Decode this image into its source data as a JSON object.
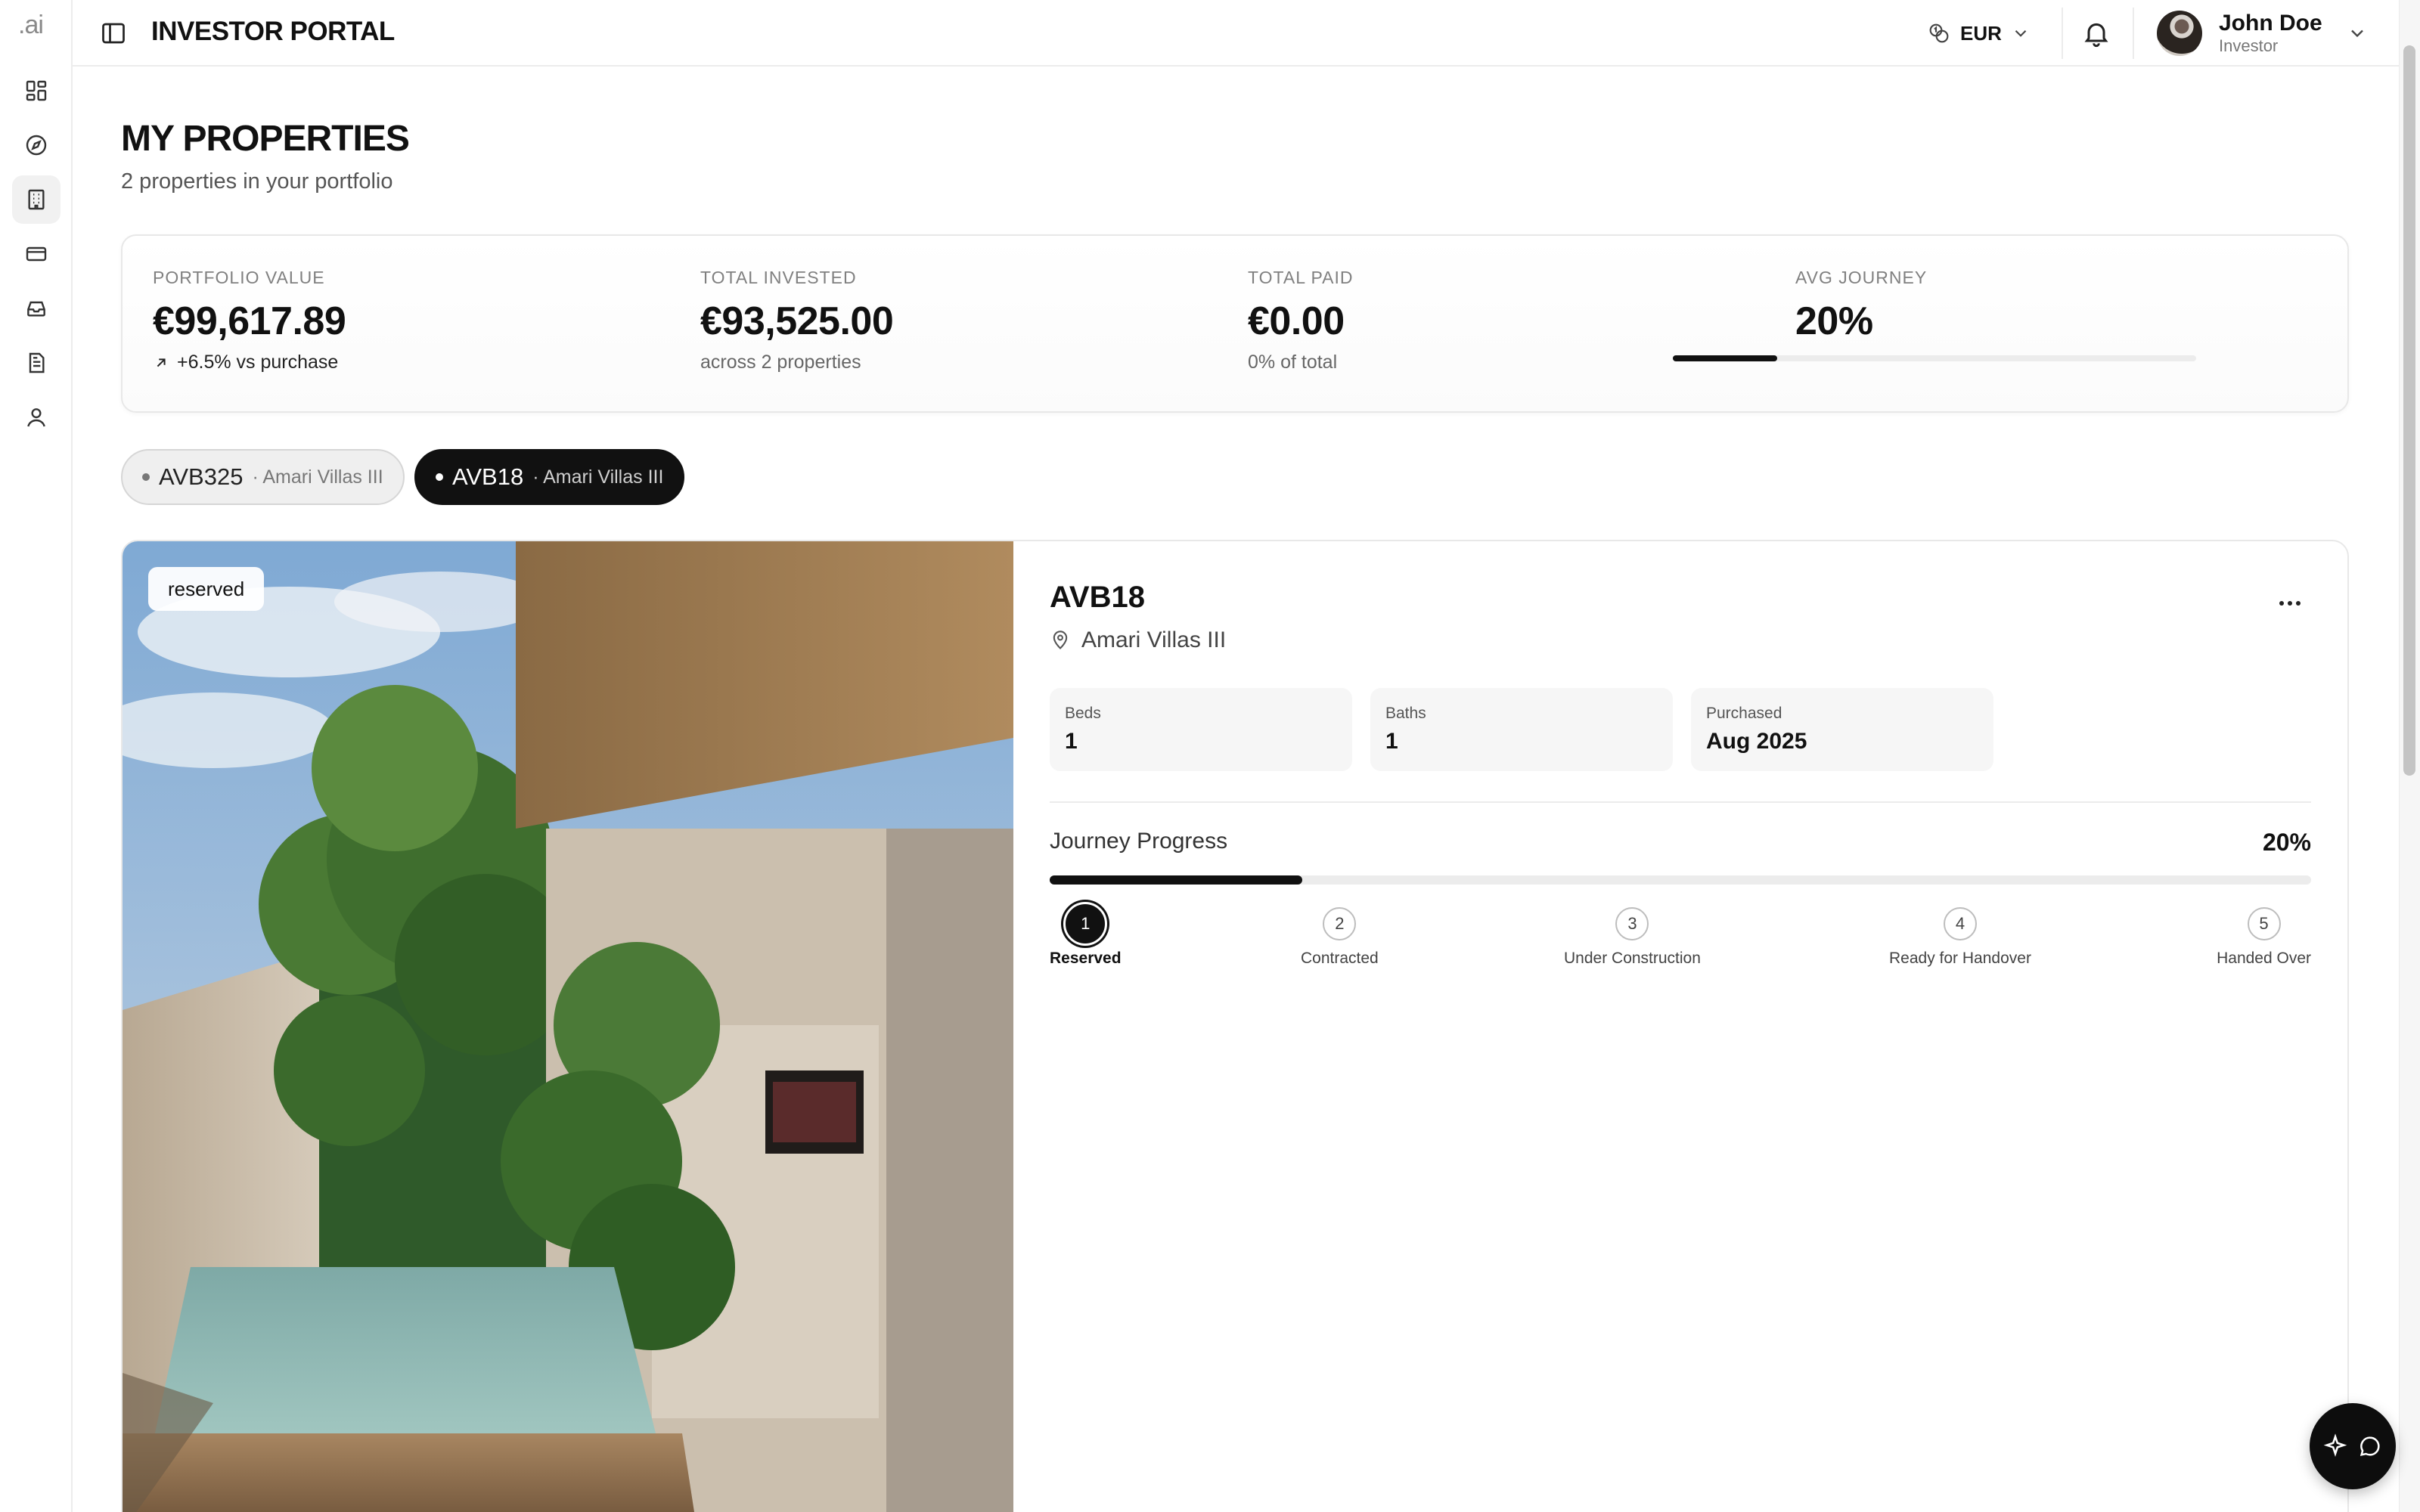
{
  "rail": {
    "logo": ".ai",
    "items": [
      {
        "icon": "dashboard-icon",
        "active": false
      },
      {
        "icon": "compass-icon",
        "active": false
      },
      {
        "icon": "building-icon",
        "active": true
      },
      {
        "icon": "credit-card-icon",
        "active": false
      },
      {
        "icon": "inbox-icon",
        "active": false
      },
      {
        "icon": "document-icon",
        "active": false
      },
      {
        "icon": "user-icon",
        "active": false
      }
    ]
  },
  "header": {
    "title": "INVESTOR PORTAL",
    "currency": "EUR",
    "user_name": "John Doe",
    "user_role": "Investor"
  },
  "page": {
    "title": "MY PROPERTIES",
    "subtitle": "2 properties in your portfolio"
  },
  "stats": {
    "portfolio_value": {
      "label": "PORTFOLIO VALUE",
      "value": "€99,617.89",
      "note": "+6.5% vs purchase"
    },
    "total_invested": {
      "label": "TOTAL INVESTED",
      "value": "€93,525.00",
      "note": "across 2 properties"
    },
    "total_paid": {
      "label": "TOTAL PAID",
      "value": "€0.00",
      "note": "0% of total"
    },
    "avg_journey": {
      "label": "AVG JOURNEY",
      "value": "20%",
      "progress": 0.2
    }
  },
  "property_tabs": [
    {
      "code": "AVB325",
      "location": "· Amari Villas III",
      "active": false
    },
    {
      "code": "AVB18",
      "location": "· Amari Villas III",
      "active": true
    }
  ],
  "property": {
    "status": "reserved",
    "code": "AVB18",
    "location": "Amari Villas III",
    "specs": {
      "beds": {
        "label": "Beds",
        "value": "1"
      },
      "baths": {
        "label": "Baths",
        "value": "1"
      },
      "purchased": {
        "label": "Purchased",
        "value": "Aug 2025"
      }
    },
    "journey": {
      "label": "Journey Progress",
      "percent_text": "20%",
      "progress": 0.2,
      "steps": [
        {
          "number": "1",
          "label": "Reserved",
          "done": true
        },
        {
          "number": "2",
          "label": "Contracted",
          "done": false
        },
        {
          "number": "3",
          "label": "Under Construction",
          "done": false
        },
        {
          "number": "4",
          "label": "Ready for Handover",
          "done": false
        },
        {
          "number": "5",
          "label": "Handed Over",
          "done": false
        }
      ]
    }
  },
  "colors": {
    "accent": "#111111",
    "border": "#e8e8e8",
    "muted_text": "#808080"
  }
}
